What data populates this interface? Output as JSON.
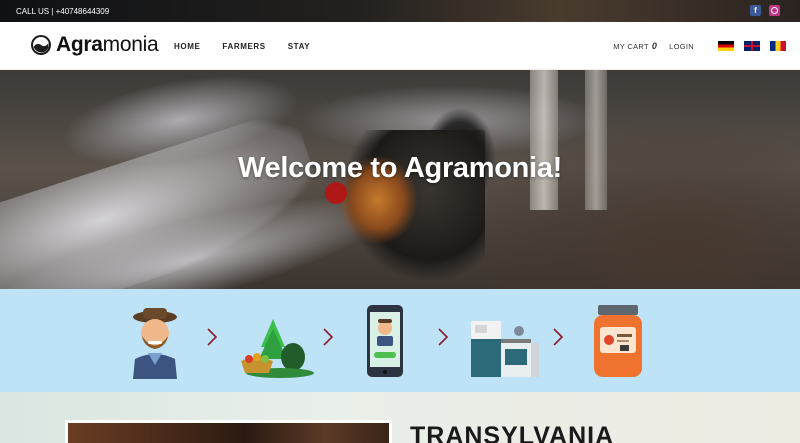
{
  "topbar": {
    "call_text": "CALL US | +40748644309",
    "socials": [
      {
        "name": "facebook-icon",
        "color": "#3b5998"
      },
      {
        "name": "instagram-icon",
        "color": "#c13584"
      }
    ]
  },
  "header": {
    "logo": {
      "bold": "Agra",
      "regular": "monia"
    },
    "nav": [
      "HOME",
      "FARMERS",
      "STAY"
    ],
    "cart_label": "MY CART",
    "cart_count": "0",
    "login_label": "LOGIN",
    "languages": [
      "German",
      "English",
      "Romanian"
    ]
  },
  "hero": {
    "title": "Welcome to Agramonia!"
  },
  "steps": {
    "background": "#bee3f6",
    "arrow_color": "#8b1a2b",
    "items": [
      {
        "icon": "farmer-icon"
      },
      {
        "icon": "farm-produce-icon"
      },
      {
        "icon": "phone-order-icon"
      },
      {
        "icon": "kitchen-icon"
      },
      {
        "icon": "jar-product-icon"
      }
    ]
  },
  "bottom": {
    "title": "TRANSYLVANIA"
  }
}
